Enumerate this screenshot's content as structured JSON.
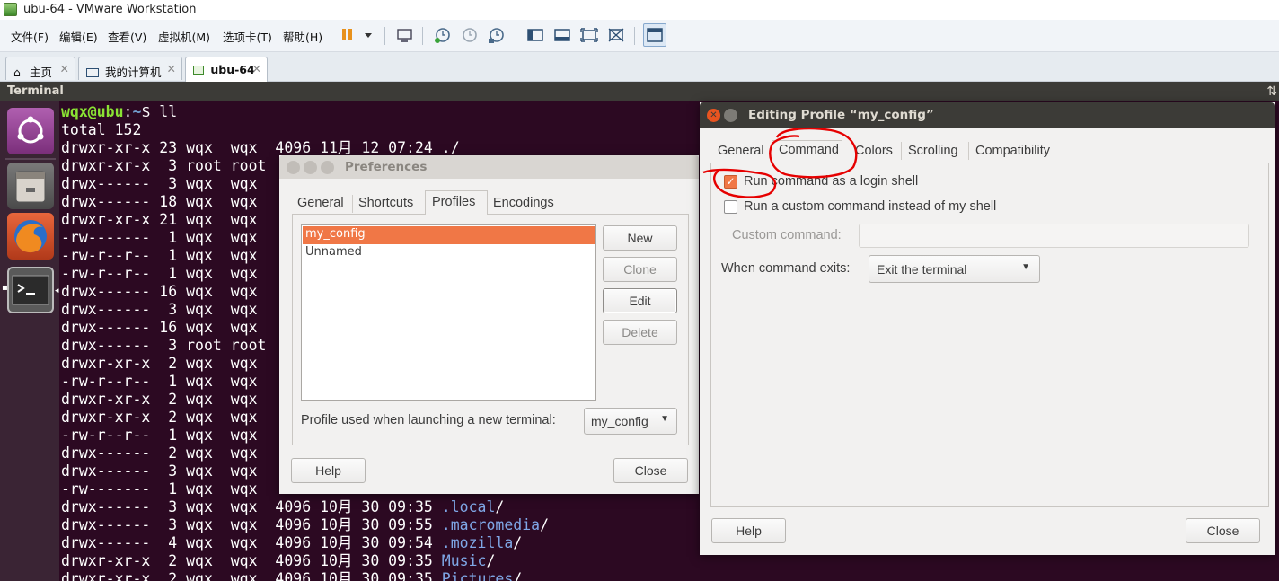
{
  "window": {
    "title": "ubu-64 - VMware Workstation"
  },
  "menu": [
    "文件(F)",
    "编辑(E)",
    "查看(V)",
    "虚拟机(M)",
    "选项卡(T)",
    "帮助(H)"
  ],
  "vm_tabs": [
    {
      "label": "主页",
      "icon": "home-icon"
    },
    {
      "label": "我的计算机",
      "icon": "computer-icon"
    },
    {
      "label": "ubu-64",
      "icon": "vm-icon",
      "active": true
    }
  ],
  "ubuntu_panel": {
    "title": "Terminal"
  },
  "terminal": {
    "prompt_user": "wqx@ubu",
    "prompt_path": "~",
    "prompt_symbol": "$",
    "command": " ll",
    "lines": [
      "total 152",
      "drwxr-xr-x 23 wqx  wqx  4096 11月 12 07:24 ./",
      "drwxr-xr-x  3 root root",
      "drwx------  3 wqx  wqx",
      "drwx------ 18 wqx  wqx",
      "drwxr-xr-x 21 wqx  wqx",
      "-rw-------  1 wqx  wqx",
      "-rw-r--r--  1 wqx  wqx",
      "-rw-r--r--  1 wqx  wqx",
      "drwx------ 16 wqx  wqx",
      "drwx------  3 wqx  wqx",
      "drwx------ 16 wqx  wqx",
      "drwx------  3 root root",
      "drwxr-xr-x  2 wqx  wqx",
      "-rw-r--r--  1 wqx  wqx",
      "drwxr-xr-x  2 wqx  wqx",
      "drwxr-xr-x  2 wqx  wqx",
      "-rw-r--r--  1 wqx  wqx",
      "drwx------  2 wqx  wqx",
      "drwx------  3 wqx  wqx",
      "-rw-------  1 wqx  wqx"
    ],
    "full_lines": [
      {
        "text": "drwx------  3 wqx  wqx  4096 10月 30 09:35 ",
        "name": ".local",
        "suffix": "/"
      },
      {
        "text": "drwx------  3 wqx  wqx  4096 10月 30 09:55 ",
        "name": ".macromedia",
        "suffix": "/"
      },
      {
        "text": "drwx------  4 wqx  wqx  4096 10月 30 09:54 ",
        "name": ".mozilla",
        "suffix": "/"
      },
      {
        "text": "drwxr-xr-x  2 wqx  wqx  4096 10月 30 09:35 ",
        "name": "Music",
        "suffix": "/"
      },
      {
        "text": "drwxr-xr-x  2 wqx  wqx  4096 10月 30 09:35 ",
        "name": "Pictures",
        "suffix": "/"
      }
    ]
  },
  "preferences": {
    "title": "Preferences",
    "tabs": [
      "General",
      "Shortcuts",
      "Profiles",
      "Encodings"
    ],
    "active_tab": "Profiles",
    "profiles": [
      "my_config",
      "Unnamed"
    ],
    "selected_profile": "my_config",
    "buttons": {
      "new": "New",
      "clone": "Clone",
      "edit": "Edit",
      "delete": "Delete",
      "help": "Help",
      "close": "Close"
    },
    "launch_label": "Profile used when launching a new terminal:",
    "launch_value": "my_config"
  },
  "editing_profile": {
    "title": "Editing Profile “my_config”",
    "tabs": [
      "General",
      "Command",
      "Colors",
      "Scrolling",
      "Compatibility"
    ],
    "active_tab": "Command",
    "login_shell_label": "Run command as a login shell",
    "login_shell_checked": true,
    "custom_command_label": "Run a custom command instead of my shell",
    "custom_command_checked": false,
    "custom_command_field_label": "Custom command:",
    "custom_command_value": "",
    "exit_label": "When command exits:",
    "exit_value": "Exit the terminal",
    "help": "Help",
    "close": "Close"
  },
  "colors": {
    "accent": "#f07746",
    "terminal_bg": "#2c0922",
    "launcher_bg": "#3a2434",
    "annotation": "#e60000"
  }
}
